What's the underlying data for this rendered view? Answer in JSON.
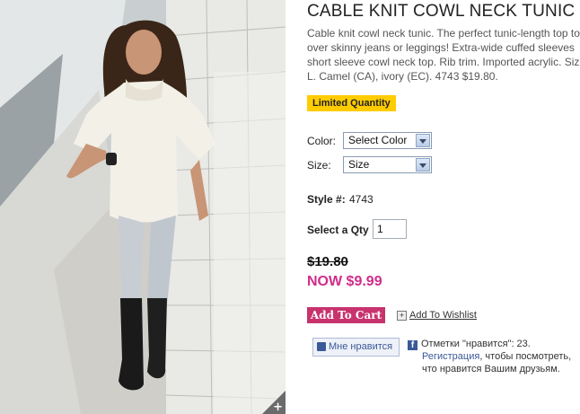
{
  "product": {
    "title": "CABLE KNIT COWL NECK TUNIC",
    "description_lines": [
      "Cable knit cowl neck tunic. The perfect tunic-length top to",
      "over skinny jeans or leggings! Extra-wide cuffed sleeves",
      "short sleeve cowl neck top. Rib trim. Imported acrylic. Siz",
      "L. Camel (CA), ivory (EC). 4743 $19.80."
    ],
    "badge": "Limited Quantity",
    "color_label": "Color:",
    "color_value": "Select Color",
    "size_label": "Size:",
    "size_value": "Size",
    "style_label": "Style #:",
    "style_value": "4743",
    "qty_label": "Select a Qty",
    "qty_value": "1",
    "old_price": "$19.80",
    "now_price": "NOW $9.99",
    "add_to_cart": "Add To Cart",
    "add_to_wishlist": "Add To Wishlist",
    "zoom_symbol": "+"
  },
  "facebook": {
    "like_button": "Мне нравится",
    "likes_text": "Отметки \"нравится\": 23.",
    "register_link": "Регистрация",
    "register_rest": ", чтобы посмотреть,",
    "line3": "что нравится Вашим друзьям."
  },
  "colors": {
    "price_now": "#d02d8a",
    "cart_button": "#c8336e",
    "badge": "#ffcc00",
    "facebook": "#3b5998"
  },
  "icons": [
    "zoom-plus-icon",
    "select-arrow-icon",
    "add-plus-icon",
    "facebook-thumb-icon",
    "facebook-f-icon"
  ]
}
